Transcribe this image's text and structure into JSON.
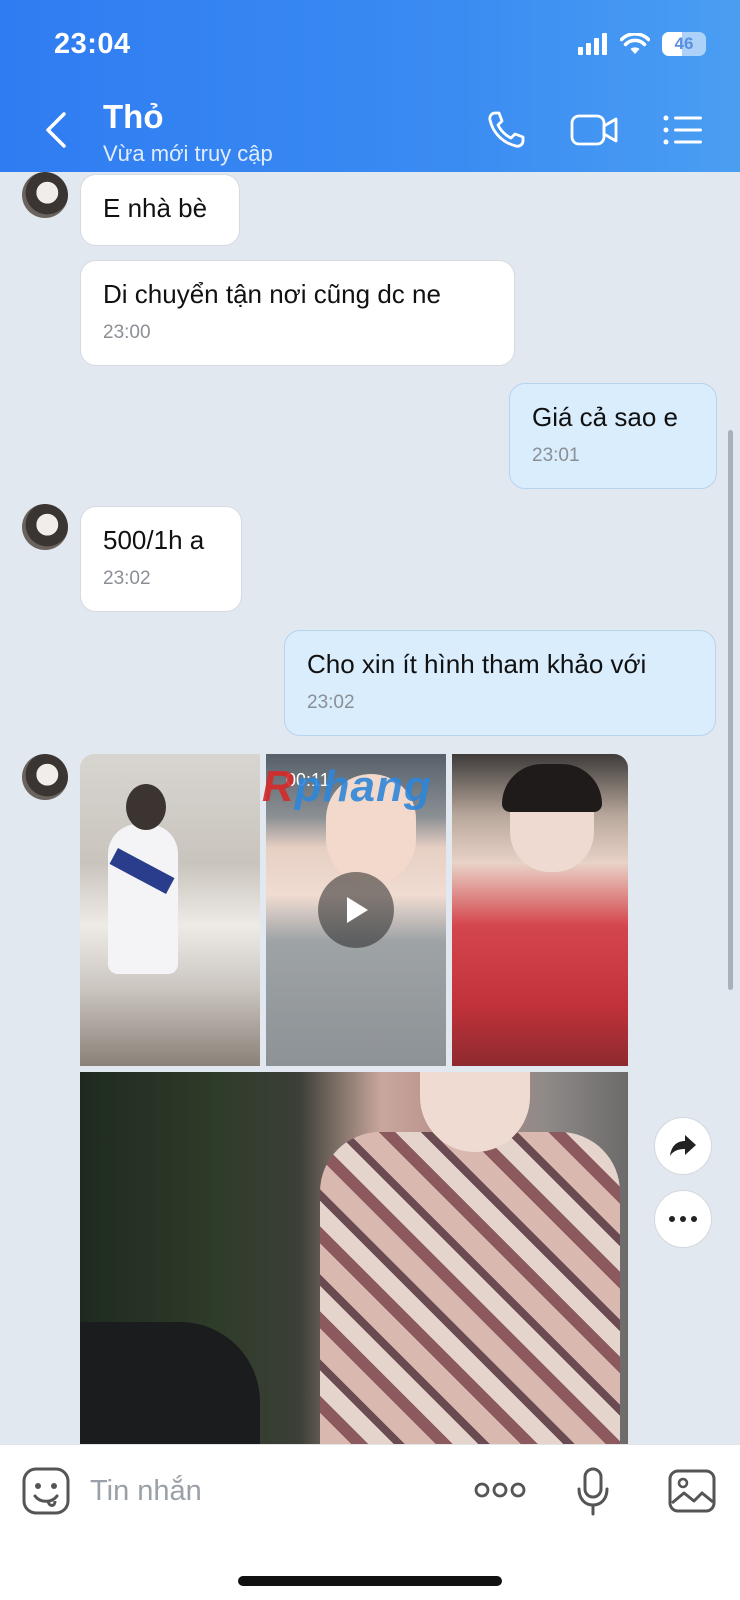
{
  "status_bar": {
    "time": "23:04",
    "battery": "46"
  },
  "header": {
    "title": "Thỏ",
    "subtitle": "Vừa mới truy cập"
  },
  "messages": [
    {
      "text": "E nhà bè",
      "time": ""
    },
    {
      "text": "Di chuyển tận nơi cũng dc ne",
      "time": "23:00"
    },
    {
      "text": "Giá cả sao e",
      "time": "23:01"
    },
    {
      "text": "500/1h a",
      "time": "23:02"
    },
    {
      "text": "Cho xin ít hình tham khảo với",
      "time": "23:02"
    }
  ],
  "media": {
    "video_duration": "00:11",
    "watermark_red": "R",
    "watermark_blue": "phang"
  },
  "input": {
    "placeholder": "Tin nhắn"
  },
  "colors": {
    "header": "#3a8bf2",
    "incoming": "#ffffff",
    "outgoing": "#d9edfc",
    "background": "#e2e8f0"
  }
}
